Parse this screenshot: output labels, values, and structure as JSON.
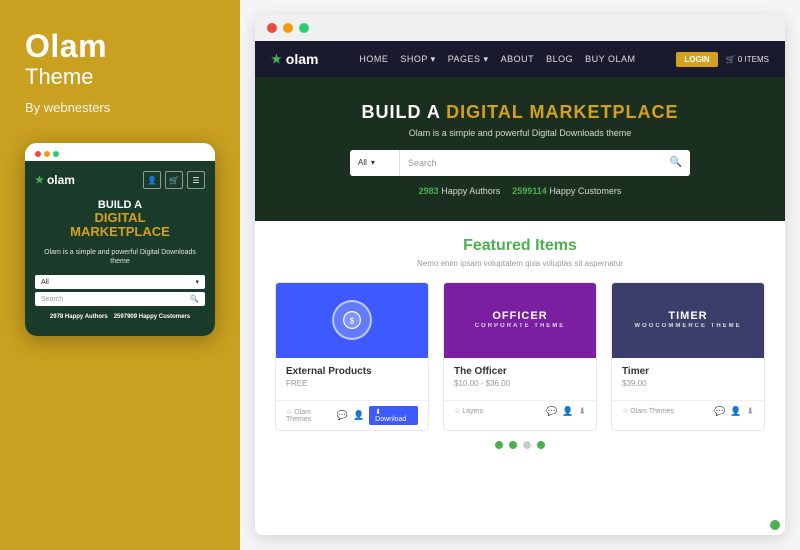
{
  "left_panel": {
    "brand": {
      "title": "Olam",
      "subtitle": "Theme",
      "by": "By webnesters"
    },
    "mobile_mockup": {
      "dots": [
        {
          "color": "#e74c3c"
        },
        {
          "color": "#f39c12"
        },
        {
          "color": "#2ecc71"
        }
      ],
      "nav": {
        "logo": "olam",
        "logo_star": "★"
      },
      "hero": {
        "build": "BUILD A",
        "digital": "DIGITAL",
        "marketplace": "MARKETPLACE",
        "desc": "Olam is a simple and powerful Digital Downloads theme"
      },
      "search": {
        "select_label": "All",
        "placeholder": "Search"
      },
      "stats": [
        {
          "number": "2978",
          "label": " Happy Authors"
        },
        {
          "number": "2597909",
          "label": " Happy Customers"
        }
      ]
    }
  },
  "right_panel": {
    "desktop_mockup": {
      "dots": [
        {
          "color": "#e74c3c"
        },
        {
          "color": "#f39c12"
        },
        {
          "color": "#2ecc71"
        }
      ],
      "nav": {
        "logo": "olam",
        "logo_star": "★",
        "links": [
          "HOME",
          "SHOP ▾",
          "PAGES ▾",
          "ABOUT",
          "BLOG",
          "BUY OLAM"
        ],
        "login": "LOGIN",
        "cart": "🛒 0 ITEMS"
      },
      "hero": {
        "title_part1": "BUILD A ",
        "title_highlight": "DIGITAL MARKETPLACE",
        "subtitle": "Olam is a simple and powerful Digital Downloads theme",
        "search_select": "All",
        "search_placeholder": "Search",
        "stats": [
          {
            "number": "2983",
            "label": " Happy Authors  "
          },
          {
            "number": "2599114",
            "label": " Happy Customers"
          }
        ]
      },
      "featured": {
        "title_part1": "Featured ",
        "title_highlight": "Items",
        "desc": "Nemo enim ipsam voluptatem quia voluptas sit aspernatur",
        "products": [
          {
            "thumb_type": "icon",
            "icon": "⬆",
            "bg": "#3d5afe",
            "name": "External Products",
            "price": "FREE",
            "author": "☆ Olam Themes",
            "actions": [
              "💬",
              "👤",
              "⬇"
            ],
            "download_label": "Download"
          },
          {
            "thumb_type": "text",
            "thumb_title": "OFFICER",
            "thumb_sub": "CORPORATE THEME",
            "bg": "#7b1fa2",
            "name": "The Officer",
            "price": "$10.00 - $36.00",
            "author": "☆ Layero",
            "actions": [
              "💬",
              "👤",
              "⬇"
            ]
          },
          {
            "thumb_type": "text",
            "thumb_title": "TIMER",
            "thumb_sub": "Woocommerce Theme",
            "bg": "#3d3d6b",
            "name": "Timer",
            "price": "$39.00",
            "author": "☆ Olam Themes",
            "actions": [
              "💬",
              "👤",
              "⬇"
            ]
          }
        ]
      },
      "pagination_dots": [
        {
          "color": "#4CAF50"
        },
        {
          "color": "#4CAF50"
        },
        {
          "color": "#ccc"
        },
        {
          "color": "#4CAF50"
        }
      ]
    }
  }
}
